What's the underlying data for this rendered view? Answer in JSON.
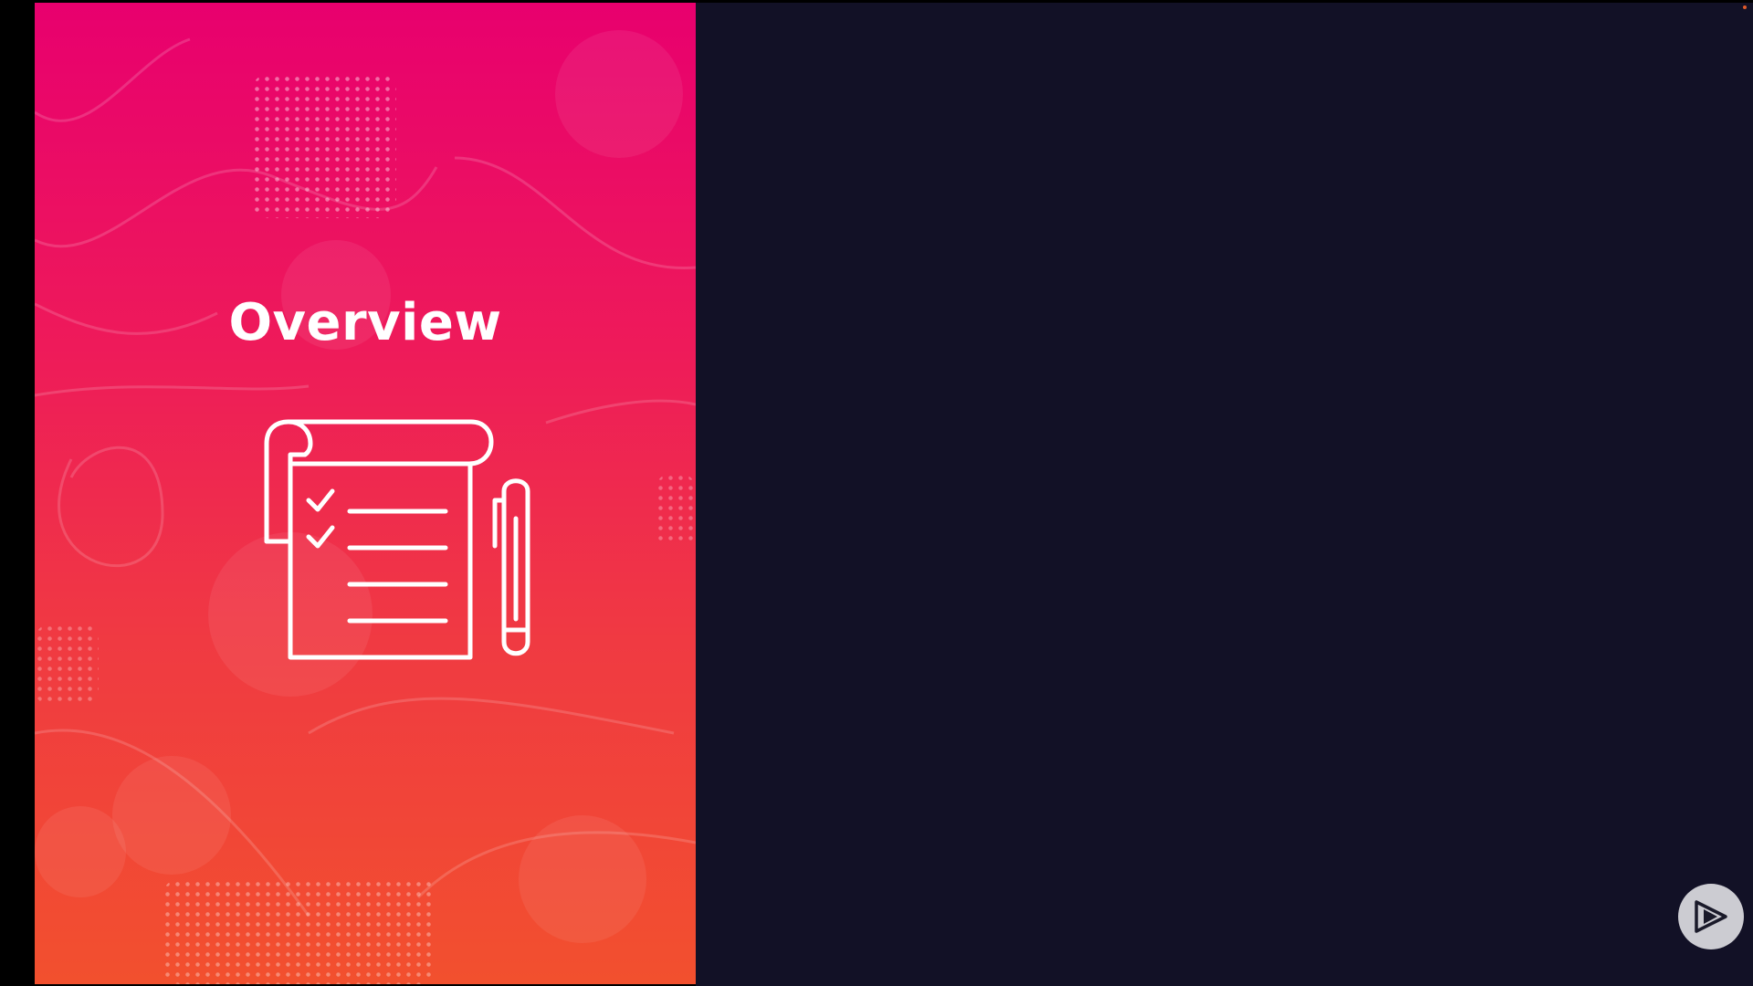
{
  "slide": {
    "title": "Overview",
    "illustration_icon": "checklist-notepad-pen-icon"
  },
  "player": {
    "play_icon": "play-logo-icon"
  },
  "colors": {
    "gradient_top": "#e8006e",
    "gradient_bottom": "#f2502e",
    "dark_background": "#121126",
    "title_text": "#ffffff"
  }
}
